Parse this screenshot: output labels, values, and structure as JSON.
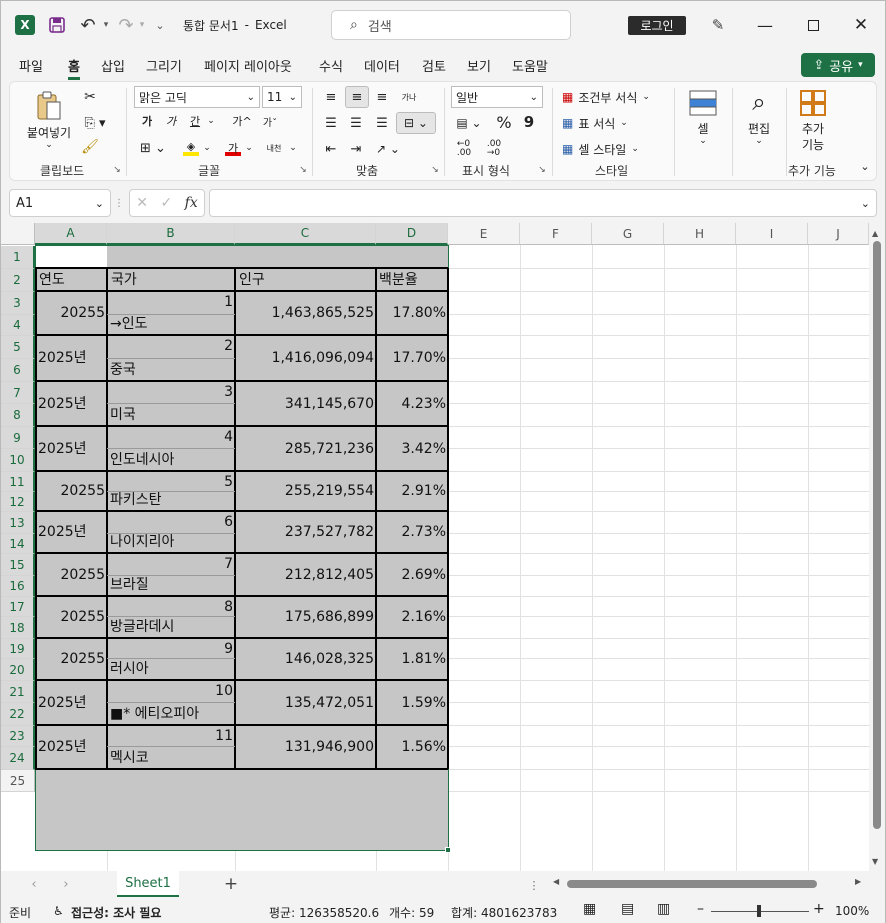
{
  "title_bar": {
    "doc_title": "통합 문서1",
    "separator": "-",
    "app_name": "Excel",
    "search_placeholder": "검색",
    "login_label": "로그인"
  },
  "menu": {
    "items": [
      "파일",
      "홈",
      "삽입",
      "그리기",
      "페이지 레이아웃",
      "수식",
      "데이터",
      "검토",
      "보기",
      "도움말"
    ],
    "share_label": "공유"
  },
  "ribbon": {
    "clipboard": {
      "paste": "붙여넣기",
      "label": "클립보드"
    },
    "font": {
      "name": "맑은 고딕",
      "size": "11",
      "bold": "가",
      "italic": "가",
      "underline": "간",
      "grow": "가^",
      "shrink": "가ˇ",
      "ruby": "내천",
      "label": "글꼴"
    },
    "alignment": {
      "wrap": "가나",
      "label": "맞춤"
    },
    "number": {
      "format": "일반",
      "percent": "%",
      "comma": "9",
      "label": "표시 형식"
    },
    "styles": {
      "conditional": "조건부 서식",
      "table": "표 서식",
      "cell": "셀 스타일",
      "label": "스타일"
    },
    "cells": {
      "cell": "셀"
    },
    "editing": {
      "edit": "편집"
    },
    "addins": {
      "line1": "추가",
      "line2": "기능",
      "label": "추가 기능"
    }
  },
  "formula_bar": {
    "name_box": "A1",
    "fx": "fx",
    "formula": ""
  },
  "columns": [
    "A",
    "B",
    "C",
    "D",
    "E",
    "F",
    "G",
    "H",
    "I",
    "J"
  ],
  "rows": [
    "1",
    "2",
    "3",
    "4",
    "5",
    "6",
    "7",
    "8",
    "9",
    "10",
    "11",
    "12",
    "13",
    "14",
    "15",
    "16",
    "17",
    "18",
    "19",
    "20",
    "21",
    "22",
    "23",
    "24",
    "25"
  ],
  "table": {
    "headers": [
      "연도",
      "국가",
      "인구",
      "백분율"
    ],
    "records": [
      {
        "year": "20255",
        "rank": "1",
        "country": "→인도",
        "population": "1,463,865,525",
        "percent": "17.80%"
      },
      {
        "year": "2025년",
        "rank": "2",
        "country": "중국",
        "population": "1,416,096,094",
        "percent": "17.70%"
      },
      {
        "year": "2025년",
        "rank": "3",
        "country": "미국",
        "population": "341,145,670",
        "percent": "4.23%"
      },
      {
        "year": "2025년",
        "rank": "4",
        "country": "인도네시아",
        "population": "285,721,236",
        "percent": "3.42%"
      },
      {
        "year": "20255",
        "rank": "5",
        "country": "파키스탄",
        "population": "255,219,554",
        "percent": "2.91%"
      },
      {
        "year": "2025년",
        "rank": "6",
        "country": "나이지리아",
        "population": "237,527,782",
        "percent": "2.73%"
      },
      {
        "year": "20255",
        "rank": "7",
        "country": "브라질",
        "population": "212,812,405",
        "percent": "2.69%"
      },
      {
        "year": "20255",
        "rank": "8",
        "country": "방글라데시",
        "population": "175,686,899",
        "percent": "2.16%"
      },
      {
        "year": "20255",
        "rank": "9",
        "country": "러시아",
        "population": "146,028,325",
        "percent": "1.81%"
      },
      {
        "year": "2025년",
        "rank": "10",
        "country": "■* 에티오피아",
        "population": "135,472,051",
        "percent": "1.59%"
      },
      {
        "year": "2025년",
        "rank": "11",
        "country": "멕시코",
        "population": "131,946,900",
        "percent": "1.56%"
      }
    ]
  },
  "sheet_tabs": {
    "active": "Sheet1",
    "add": "+"
  },
  "status": {
    "ready": "준비",
    "accessibility": "접근성: 조사 필요",
    "average": "평균: 126358520.6",
    "count": "개수: 59",
    "sum": "합계: 4801623783",
    "zoom": "100%"
  },
  "colors": {
    "accent": "#1e7145",
    "selection": "#c6c6c6",
    "brand": "#217346"
  }
}
